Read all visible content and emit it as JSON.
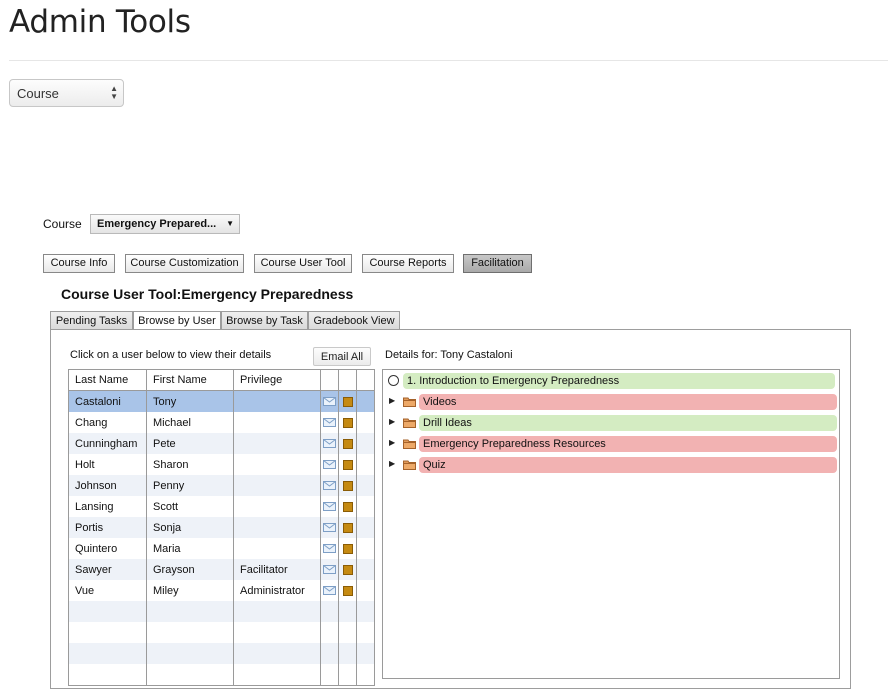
{
  "page": {
    "title": "Admin Tools"
  },
  "top_select": {
    "value": "Course"
  },
  "course_picker": {
    "label": "Course",
    "value": "Emergency Prepared..."
  },
  "nav_buttons": [
    {
      "label": "Course Info"
    },
    {
      "label": "Course Customization"
    },
    {
      "label": "Course User Tool"
    },
    {
      "label": "Course Reports"
    },
    {
      "label": "Facilitation",
      "active": true
    }
  ],
  "tool": {
    "heading": "Course User Tool:Emergency Preparedness"
  },
  "tabs": [
    {
      "label": "Pending Tasks"
    },
    {
      "label": "Browse by User",
      "active": true
    },
    {
      "label": "Browse by Task"
    },
    {
      "label": "Gradebook View"
    }
  ],
  "users_panel": {
    "instruction": "Click on a user below to view their details",
    "email_all_label": "Email All",
    "columns": [
      "Last Name",
      "First Name",
      "Privilege"
    ],
    "rows": [
      {
        "last": "Castaloni",
        "first": "Tony",
        "privilege": "",
        "selected": true
      },
      {
        "last": "Chang",
        "first": "Michael",
        "privilege": ""
      },
      {
        "last": "Cunningham",
        "first": "Pete",
        "privilege": ""
      },
      {
        "last": "Holt",
        "first": "Sharon",
        "privilege": ""
      },
      {
        "last": "Johnson",
        "first": "Penny",
        "privilege": ""
      },
      {
        "last": "Lansing",
        "first": "Scott",
        "privilege": ""
      },
      {
        "last": "Portis",
        "first": "Sonja",
        "privilege": ""
      },
      {
        "last": "Quintero",
        "first": "Maria",
        "privilege": ""
      },
      {
        "last": "Sawyer",
        "first": "Grayson",
        "privilege": "Facilitator"
      },
      {
        "last": "Vue",
        "first": "Miley",
        "privilege": "Administrator"
      }
    ]
  },
  "details": {
    "label": "Details for: Tony Castaloni",
    "items": [
      {
        "label": "1.  Introduction to Emergency Preparedness",
        "kind": "task",
        "status": "green"
      },
      {
        "label": "Videos",
        "kind": "folder",
        "status": "red"
      },
      {
        "label": "Drill Ideas",
        "kind": "folder",
        "status": "green"
      },
      {
        "label": "Emergency Preparedness Resources",
        "kind": "folder",
        "status": "red"
      },
      {
        "label": "Quiz",
        "kind": "folder",
        "status": "red"
      }
    ]
  },
  "colors": {
    "selected_row": "#a9c4e8",
    "complete": "#d4ecc2",
    "incomplete": "#f2b2b2",
    "folder": "#e09a5a"
  }
}
